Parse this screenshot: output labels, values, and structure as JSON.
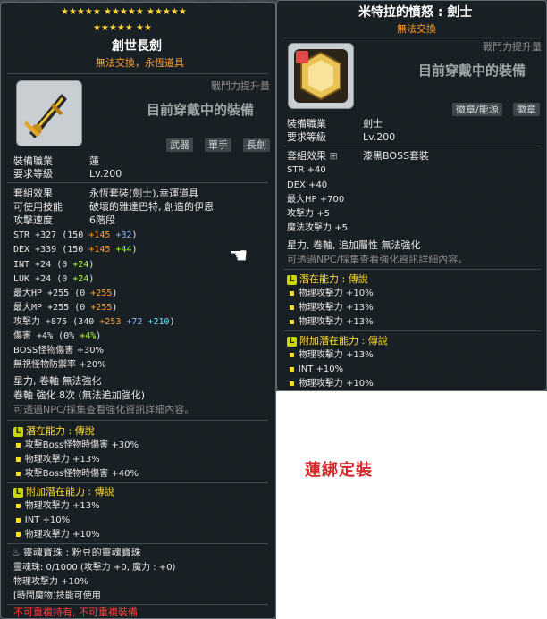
{
  "left": {
    "stars_row1": "★★★★★ ★★★★★ ★★★★★",
    "stars_row2": "★★★★★ ★★",
    "item_name": "創世長劍",
    "item_tag": "無法交換，永恆道具",
    "combat_power_label": "戰鬥力提升量",
    "wearing_label": "目前穿戴中的裝備",
    "tags": [
      "武器",
      "單手",
      "長劍"
    ],
    "job_label": "裝備職業",
    "job_value": "蓮",
    "level_label": "要求等級",
    "level_value": "Lv.200",
    "set_label": "套組效果",
    "set_value": "永恆套裝(劍士),幸運道具",
    "skill_label": "可使用技能",
    "skill_value": "破壞的雅達巴特, 創造的伊恩",
    "speed_label": "攻擊速度",
    "speed_value": "6階段",
    "stats": [
      {
        "name": "STR",
        "total": "+327",
        "open": "(150",
        "a": "+145",
        "b": "+32",
        "close": ")"
      },
      {
        "name": "DEX",
        "total": "+339",
        "open": "(150",
        "a": "+145",
        "b": "+44",
        "close": ")"
      },
      {
        "name": "INT",
        "total": "+24",
        "open": "(0",
        "a": "",
        "b": "+24",
        "close": ")"
      },
      {
        "name": "LUK",
        "total": "+24",
        "open": "(0",
        "a": "",
        "b": "+24",
        "close": ")"
      },
      {
        "name": "最大HP",
        "total": "+255",
        "open": "(0",
        "a": "+255",
        "b": "",
        "close": ")"
      },
      {
        "name": "最大MP",
        "total": "+255",
        "open": "(0",
        "a": "+255",
        "b": "",
        "close": ")"
      }
    ],
    "attack": {
      "name": "攻擊力",
      "total": "+875",
      "open": "(340",
      "a": "+253",
      "b": "+72",
      "c": "+210",
      "close": ")"
    },
    "damage": {
      "name": "傷害",
      "total": "+4%",
      "open": "(0%",
      "a": "+4%",
      "close": ")"
    },
    "boss": {
      "name": "BOSS怪物傷害",
      "value": "+30%"
    },
    "ignore": {
      "name": "無視怪物防禦率",
      "value": "+20%"
    },
    "star_line": "星力, 卷軸 無法強化",
    "scroll_line": "卷軸 強化 8次 (無法追加強化)",
    "npc_line": "可透過NPC/採集查看強化資訊詳細內容。",
    "potential_title": "潛在能力 : 傳說",
    "potential": [
      "攻擊Boss怪物時傷害 +30%",
      "物理攻擊力 +13%",
      "攻擊Boss怪物時傷害 +40%"
    ],
    "add_title": "附加潛在能力 : 傳說",
    "additional": [
      "物理攻擊力 +13%",
      "INT +10%",
      "物理攻擊力 +10%"
    ],
    "soul_weapon": "靈魂寶珠 : 粉豆的靈魂寶珠",
    "soul_orb": "靈魂珠:  0/1000 (攻擊力 +0,  魔力 : +0)",
    "soul_atk": "物理攻擊力 +10%",
    "soul_skill": "[時間魔物]技能可使用",
    "footer": "不可重複持有, 不可重複裝備"
  },
  "right": {
    "item_name": "米特拉的憤怒 : 劍士",
    "item_tag": "無法交換",
    "combat_power_label": "戰鬥力提升量",
    "wearing_label": "目前穿戴中的裝備",
    "tags": [
      "徽章/能源",
      "徽章"
    ],
    "job_label": "裝備職業",
    "job_value": "劍士",
    "level_label": "要求等級",
    "level_value": "Lv.200",
    "set_label": "套組效果",
    "set_value": "漆黑BOSS套裝",
    "stats": [
      {
        "name": "STR",
        "value": "+40"
      },
      {
        "name": "DEX",
        "value": "+40"
      },
      {
        "name": "最大HP",
        "value": "+700"
      },
      {
        "name": "攻擊力",
        "value": "+5"
      },
      {
        "name": "魔法攻擊力",
        "value": "+5"
      }
    ],
    "star_line": "星力, 卷軸, 追加屬性 無法強化",
    "npc_line": "可透過NPC/採集查看強化資訊詳細內容。",
    "potential_title": "潛在能力 : 傳說",
    "potential": [
      "物理攻擊力 +10%",
      "物理攻擊力 +13%",
      "物理攻擊力 +13%"
    ],
    "add_title": "附加潛在能力 : 傳說",
    "additional": [
      "物理攻擊力 +13%",
      "INT +10%",
      "物理攻擊力 +10%"
    ]
  },
  "stamp": "蓮綁定裝",
  "potential_badge": "L",
  "colors": {
    "orange": "#ff9f2e",
    "green": "#a6ff2b",
    "stamp": "#d8262a",
    "stars": "#ffd83d"
  }
}
